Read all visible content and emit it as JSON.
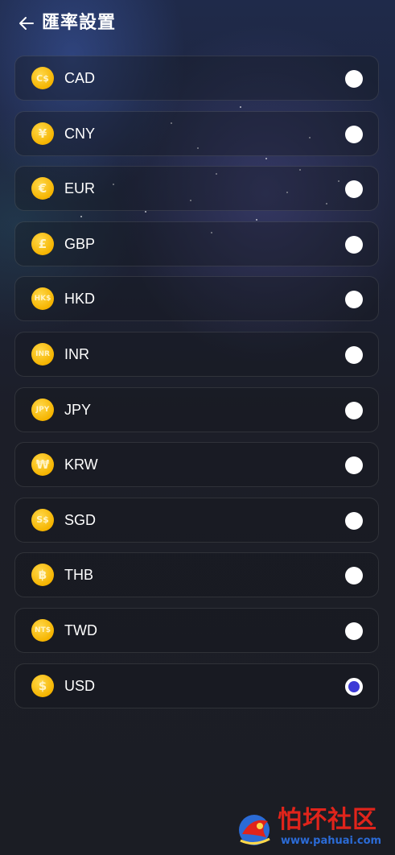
{
  "header": {
    "back_icon": "arrow-left-icon",
    "title": "匯率設置"
  },
  "currencies": [
    {
      "code": "CAD",
      "symbol": "C$",
      "selected": false
    },
    {
      "code": "CNY",
      "symbol": "¥",
      "selected": false
    },
    {
      "code": "EUR",
      "symbol": "€",
      "selected": false
    },
    {
      "code": "GBP",
      "symbol": "£",
      "selected": false
    },
    {
      "code": "HKD",
      "symbol": "HK$",
      "selected": false
    },
    {
      "code": "INR",
      "symbol": "INR",
      "selected": false
    },
    {
      "code": "JPY",
      "symbol": "JPY",
      "selected": false
    },
    {
      "code": "KRW",
      "symbol": "₩",
      "selected": false
    },
    {
      "code": "SGD",
      "symbol": "S$",
      "selected": false
    },
    {
      "code": "THB",
      "symbol": "฿",
      "selected": false
    },
    {
      "code": "TWD",
      "symbol": "NT$",
      "selected": false
    },
    {
      "code": "USD",
      "symbol": "$",
      "selected": true
    }
  ],
  "colors": {
    "accent": "#3d3ad6",
    "coin": "#f5b400",
    "background": "#1b1d24"
  },
  "watermark": {
    "title": "怕坏社区",
    "url": "www.pahuai.com"
  }
}
